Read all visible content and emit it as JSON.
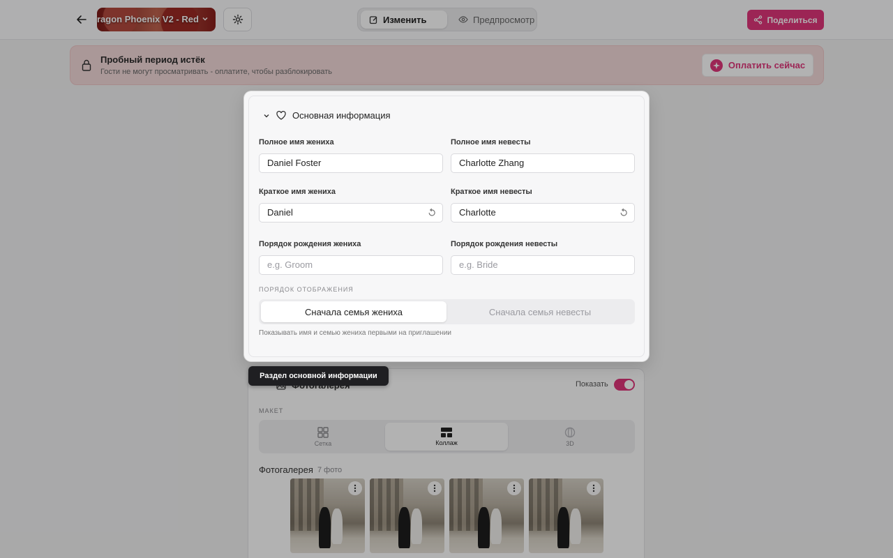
{
  "topbar": {
    "template_name": "ragon Phoenix V2 - Red",
    "mode_edit": "Изменить",
    "mode_preview": "Предпросмотр",
    "share": "Поделиться"
  },
  "banner": {
    "title": "Пробный период истёк",
    "subtitle": "Гости не могут просматривать - оплатите, чтобы разблокировать",
    "pay": "Оплатить сейчас"
  },
  "basic_info": {
    "section_title": "Основная информация",
    "groom_full_label": "Полное имя жениха",
    "groom_full_value": "Daniel Foster",
    "bride_full_label": "Полное имя невесты",
    "bride_full_value": "Charlotte Zhang",
    "groom_short_label": "Краткое имя жениха",
    "groom_short_value": "Daniel",
    "bride_short_label": "Краткое имя невесты",
    "bride_short_value": "Charlotte",
    "groom_order_label": "Порядок рождения жениха",
    "groom_order_placeholder": "e.g. Groom",
    "bride_order_label": "Порядок рождения невесты",
    "bride_order_placeholder": "e.g. Bride",
    "display_order_label": "ПОРЯДОК ОТОБРАЖЕНИЯ",
    "option_groom_first": "Сначала семья жениха",
    "option_bride_first": "Сначала семья невесты",
    "hint": "Показывать имя и семью жениха первыми на приглашении"
  },
  "tooltip": "Раздел основной информации",
  "gallery": {
    "title": "Фотогалерея",
    "show_label": "Показать",
    "layout_label": "МАКЕТ",
    "layout_options": [
      "Сетка",
      "Коллаж",
      "3D"
    ],
    "photos_label": "Фотогалерея",
    "photos_count": "7 фото"
  },
  "colors": {
    "accent": "#e0367a",
    "banner_bg": "#f4dada"
  }
}
